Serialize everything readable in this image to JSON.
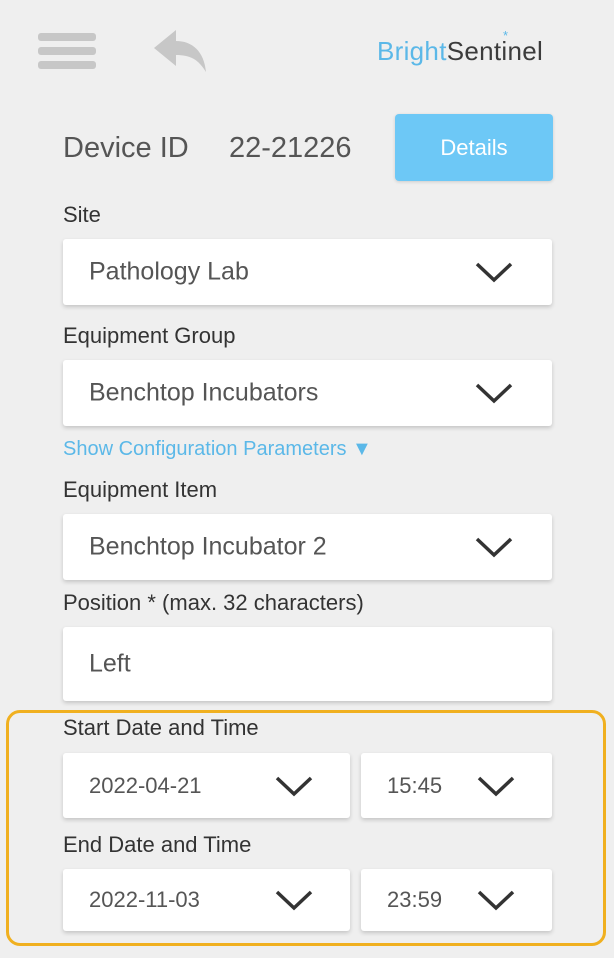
{
  "header": {
    "logo_part1": "Bright",
    "logo_part2": "Sentinel",
    "logo_mark": "*",
    "menu_icon": "hamburger-menu-icon",
    "back_icon": "back-arrow-icon"
  },
  "device": {
    "label": "Device ID",
    "id": "22-21226",
    "details_label": "Details"
  },
  "site": {
    "label": "Site",
    "value": "Pathology Lab"
  },
  "equipment_group": {
    "label": "Equipment Group",
    "value": "Benchtop Incubators"
  },
  "config_link": "Show Configuration Parameters ▼",
  "equipment_item": {
    "label": "Equipment Item",
    "value": "Benchtop Incubator 2"
  },
  "position": {
    "label": "Position *  (max. 32 characters)",
    "value": "Left"
  },
  "start": {
    "label": "Start Date and Time",
    "date": "2022-04-21",
    "time": "15:45"
  },
  "end": {
    "label": "End Date and Time",
    "date": "2022-11-03",
    "time": "23:59"
  },
  "colors": {
    "accent": "#5bb8e8",
    "button": "#6dc8f6",
    "highlight": "#f0b020"
  }
}
